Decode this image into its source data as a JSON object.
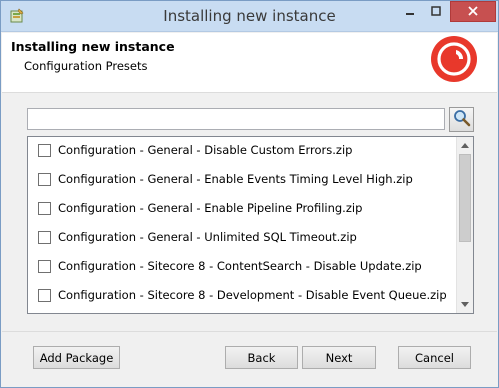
{
  "window": {
    "title": "Installing new instance",
    "icons": {
      "app": "installer-app-icon",
      "minimize": "minimize-icon",
      "maximize": "maximize-icon",
      "close": "close-icon"
    },
    "colors": {
      "titlebar": "#c8dcf2",
      "close_button": "#c75050"
    }
  },
  "header": {
    "title": "Installing new instance",
    "subtitle": "Configuration Presets",
    "logo": "sitecore-logo",
    "logo_color": "#e8382b"
  },
  "search": {
    "value": "",
    "button_icon": "magnifier-icon"
  },
  "packages": [
    {
      "label": "Configuration - General - Disable Custom Errors.zip",
      "checked": false
    },
    {
      "label": "Configuration - General - Enable Events Timing Level High.zip",
      "checked": false
    },
    {
      "label": "Configuration - General - Enable Pipeline Profiling.zip",
      "checked": false
    },
    {
      "label": "Configuration - General - Unlimited SQL Timeout.zip",
      "checked": false
    },
    {
      "label": "Configuration - Sitecore 8 - ContentSearch - Disable Update.zip",
      "checked": false
    },
    {
      "label": "Configuration - Sitecore 8 - Development - Disable Event Queue.zip",
      "checked": false
    }
  ],
  "footer": {
    "add_package": "Add Package",
    "back": "Back",
    "next": "Next",
    "cancel": "Cancel"
  }
}
